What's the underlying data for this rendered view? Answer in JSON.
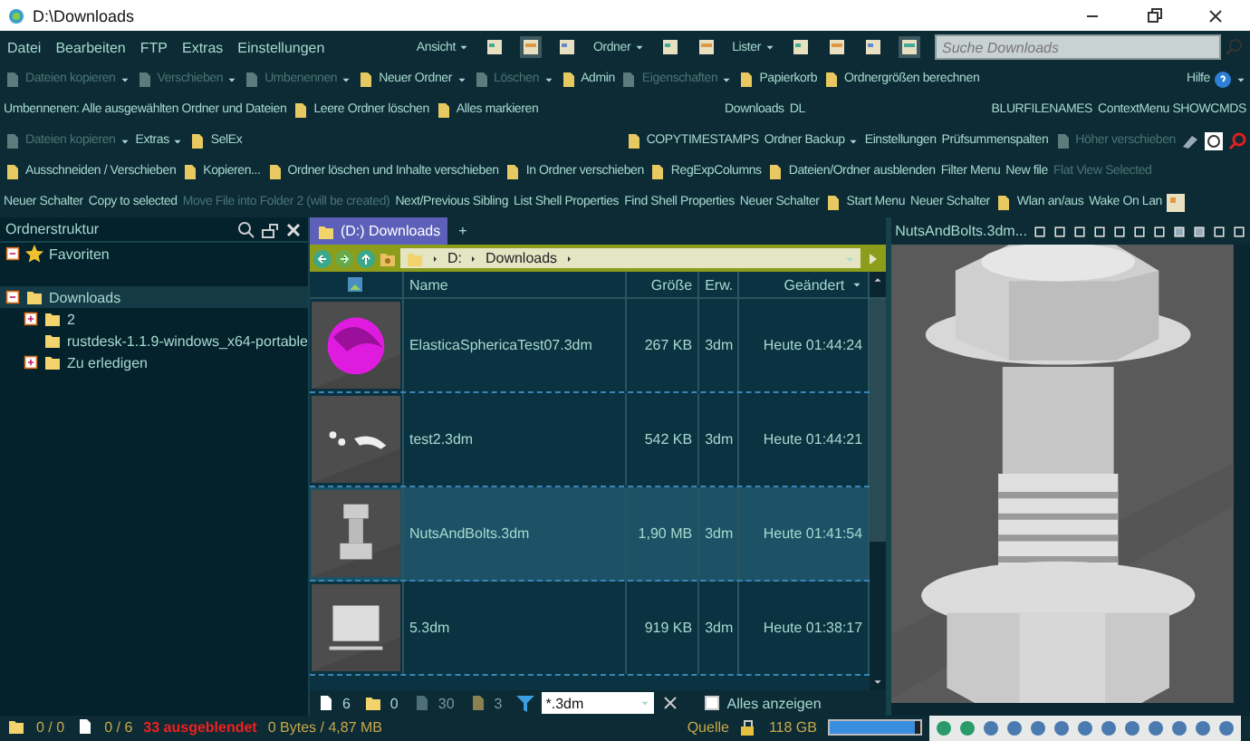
{
  "window": {
    "title": "D:\\Downloads"
  },
  "menu": [
    "Datei",
    "Bearbeiten",
    "FTP",
    "Extras",
    "Einstellungen"
  ],
  "view_menus": [
    "Ansicht",
    "Ordner",
    "Lister"
  ],
  "search": {
    "placeholder": "Suche Downloads"
  },
  "toolbar_rows": [
    {
      "groups": [
        [
          {
            "label": "Dateien kopieren",
            "kind": "icon-text",
            "disabled": true,
            "dropdown": true
          },
          {
            "label": "Verschieben",
            "kind": "icon-text",
            "disabled": true,
            "dropdown": true
          },
          {
            "label": "Umbenennen",
            "kind": "icon-text",
            "disabled": true,
            "dropdown": true
          },
          {
            "label": "Neuer Ordner",
            "kind": "icon-text",
            "disabled": false,
            "dropdown": true
          },
          {
            "label": "Löschen",
            "kind": "icon-text",
            "disabled": true,
            "dropdown": true
          },
          {
            "label": "Admin",
            "kind": "icon-text",
            "disabled": false,
            "dropdown": false
          },
          {
            "label": "Eigenschaften",
            "kind": "icon-text",
            "disabled": true,
            "dropdown": true
          },
          {
            "label": "Papierkorb",
            "kind": "icon-text",
            "disabled": false,
            "dropdown": false
          },
          {
            "label": "Ordnergrößen berechnen",
            "kind": "icon-text",
            "disabled": false,
            "dropdown": false
          }
        ],
        [
          {
            "label": "Hilfe",
            "kind": "help",
            "disabled": false,
            "dropdown": true
          }
        ]
      ]
    },
    {
      "groups": [
        [
          {
            "label": "Umbennenen: Alle ausgewählten Ordner und Dateien",
            "kind": "text",
            "disabled": false,
            "dropdown": false
          },
          {
            "label": "Leere Ordner löschen",
            "kind": "icon-text",
            "disabled": false,
            "dropdown": false
          },
          {
            "label": "Alles markieren",
            "kind": "icon-text",
            "disabled": false,
            "dropdown": false
          }
        ],
        [
          {
            "label": "Downloads",
            "kind": "text",
            "disabled": false,
            "dropdown": false
          },
          {
            "label": "DL",
            "kind": "text",
            "disabled": false,
            "dropdown": false
          }
        ],
        [
          {
            "label": "BLURFILENAMES",
            "kind": "text",
            "disabled": false,
            "dropdown": false
          },
          {
            "label": "ContextMenu SHOWCMDS",
            "kind": "text",
            "disabled": false,
            "dropdown": false
          }
        ]
      ]
    },
    {
      "groups": [
        [
          {
            "label": "Dateien kopieren",
            "kind": "icon-text",
            "disabled": true,
            "dropdown": true
          },
          {
            "label": "Extras",
            "kind": "text",
            "disabled": false,
            "dropdown": true
          },
          {
            "label": "SelEx",
            "kind": "icon-text",
            "disabled": false,
            "dropdown": false
          }
        ],
        [
          {
            "label": "COPYTIMESTAMPS",
            "kind": "icon-text",
            "disabled": false,
            "dropdown": false
          },
          {
            "label": "Ordner Backup",
            "kind": "text",
            "disabled": false,
            "dropdown": true
          },
          {
            "label": "Einstellungen",
            "kind": "text",
            "disabled": false,
            "dropdown": false
          },
          {
            "label": "Prüfsummenspalten",
            "kind": "text",
            "disabled": false,
            "dropdown": false
          },
          {
            "label": "Höher verschieben",
            "kind": "icon-text",
            "disabled": true,
            "dropdown": false
          }
        ]
      ]
    },
    {
      "groups": [
        [
          {
            "label": "Ausschneiden / Verschieben",
            "kind": "icon-text",
            "disabled": false,
            "dropdown": false
          },
          {
            "label": "Kopieren...",
            "kind": "icon-text",
            "disabled": false,
            "dropdown": false
          },
          {
            "label": "Ordner löschen und Inhalte verschieben",
            "kind": "icon-text",
            "disabled": false,
            "dropdown": false
          },
          {
            "label": "In Ordner verschieben",
            "kind": "icon-text",
            "disabled": false,
            "dropdown": false
          },
          {
            "label": "RegExpColumns",
            "kind": "icon-text",
            "disabled": false,
            "dropdown": false
          },
          {
            "label": "Dateien/Ordner ausblenden",
            "kind": "icon-text",
            "disabled": false,
            "dropdown": false
          },
          {
            "label": "Filter Menu",
            "kind": "text",
            "disabled": false,
            "dropdown": false
          },
          {
            "label": "New file",
            "kind": "text",
            "disabled": false,
            "dropdown": false
          },
          {
            "label": "Flat View Selected",
            "kind": "text",
            "disabled": true,
            "dropdown": false
          }
        ]
      ]
    },
    {
      "groups": [
        [
          {
            "label": "Neuer Schalter",
            "kind": "text",
            "disabled": false,
            "dropdown": false
          },
          {
            "label": "Copy to selected",
            "kind": "text",
            "disabled": false,
            "dropdown": false
          },
          {
            "label": "Move File into Folder 2 (will be created)",
            "kind": "text",
            "disabled": true,
            "dropdown": false
          },
          {
            "label": "Next/Previous Sibling",
            "kind": "text",
            "disabled": false,
            "dropdown": false
          },
          {
            "label": "List Shell Properties",
            "kind": "text",
            "disabled": false,
            "dropdown": false
          },
          {
            "label": "Find Shell Properties",
            "kind": "text",
            "disabled": false,
            "dropdown": false
          },
          {
            "label": "Neuer Schalter",
            "kind": "text",
            "disabled": false,
            "dropdown": false
          },
          {
            "label": "Start Menu",
            "kind": "icon-text",
            "disabled": false,
            "dropdown": false
          },
          {
            "label": "Neuer Schalter",
            "kind": "text",
            "disabled": false,
            "dropdown": false
          },
          {
            "label": "Wlan an/aus",
            "kind": "icon-text",
            "disabled": false,
            "dropdown": false
          },
          {
            "label": "Wake On Lan",
            "kind": "text",
            "disabled": false,
            "dropdown": false
          }
        ]
      ]
    }
  ],
  "tree": {
    "title": "Ordnerstruktur",
    "items": [
      {
        "label": "Favoriten",
        "kind": "favorites",
        "has_children": true,
        "expanded": true,
        "selected": false
      },
      {
        "label": "Downloads",
        "kind": "folder",
        "has_children": true,
        "expanded": true,
        "selected": true,
        "children": [
          {
            "label": "2",
            "kind": "folder",
            "has_children": true,
            "expanded": false,
            "selected": false
          },
          {
            "label": "rustdesk-1.1.9-windows_x64-portable",
            "kind": "folder",
            "has_children": false,
            "expanded": false,
            "selected": false
          },
          {
            "label": "Zu erledigen",
            "kind": "folder",
            "has_children": true,
            "expanded": false,
            "selected": false
          }
        ]
      }
    ]
  },
  "tabs": [
    {
      "label": "(D:) Downloads",
      "selected": true
    },
    {
      "label": "+",
      "selected": false
    }
  ],
  "breadcrumb": [
    "D:",
    "Downloads"
  ],
  "columns": [
    "Name",
    "Größe",
    "Erw.",
    "Geändert"
  ],
  "rows": [
    {
      "name": "ElasticaSphericaTest07.3dm",
      "size": "267 KB",
      "ext": "3dm",
      "modified": "Heute  01:44:24",
      "selected": false
    },
    {
      "name": "test2.3dm",
      "size": "542 KB",
      "ext": "3dm",
      "modified": "Heute  01:44:21",
      "selected": false
    },
    {
      "name": "NutsAndBolts.3dm",
      "size": "1,90 MB",
      "ext": "3dm",
      "modified": "Heute  01:41:54",
      "selected": true
    },
    {
      "name": "5.3dm",
      "size": "919 KB",
      "ext": "3dm",
      "modified": "Heute  01:38:17",
      "selected": false
    }
  ],
  "filter_bar": {
    "counts": [
      "6",
      "0",
      "30",
      "3"
    ],
    "filter": "*.3dm",
    "show_all": {
      "label": "Alles anzeigen",
      "checked": false
    }
  },
  "status": {
    "folders": "0 / 0",
    "files": "0 / 6",
    "hidden": "33 ausgeblendet",
    "size": "0 Bytes / 4,87 MB",
    "source": "Quelle",
    "free": "118 GB",
    "level": 0.93
  },
  "preview": {
    "title": "NutsAndBolts.3dm..."
  }
}
